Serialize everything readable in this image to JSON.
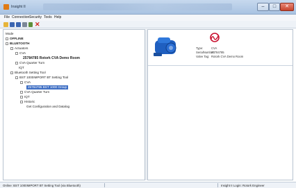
{
  "window": {
    "title": "Insight II",
    "minimize_glyph": "–",
    "maximize_glyph": "□",
    "close_glyph": "✕"
  },
  "menu": [
    "File",
    "Connection",
    "Security",
    "Tools",
    "Help"
  ],
  "toolbar": {
    "icons": [
      "open-icon",
      "save-icon",
      "save-all-icon",
      "print-icon",
      "back-icon",
      "delete-icon"
    ],
    "delete_color": "#d3261d"
  },
  "tree": {
    "root": "Mode",
    "offline": "OFFLINE",
    "bluetooth": "BLUETOOTH",
    "actuators": "Actuators",
    "cva": "CVA",
    "device": "25784785 Rotork CVA Demo Room",
    "cva_quarter_turn": "CVA Quarter Turn",
    "iqt": "IQT",
    "bst_group": "Bluetooth Setting Tool",
    "bst": "BST 1000IMPORT BT Setting Tool",
    "bst_cva": "CVA",
    "selected": "25784785 BST 1000 Group",
    "bst_cva_qt": "CVA Quarter Turn",
    "bst_iqt": "IQT",
    "historic": "Historic",
    "get_config": "Get Configuration and Datalog"
  },
  "device_info": {
    "type_label": "Type:",
    "type_value": "CVA",
    "serial_label": "SerialNumber:",
    "serial_value": "25784785",
    "tag_label": "Valve Tag:",
    "tag_value": "Rotork CVA Demo Room"
  },
  "status": {
    "left": "Online: BST 1000IMPORT BT Setting Tool (via Bluetooth)",
    "right": "Insight II Login: Rotork Engineer"
  },
  "colors": {
    "titlebar": "#b5cbe6",
    "selection": "#3f6fc4",
    "actuator_blue": "#1f5fc0",
    "logo_red": "#c8102e"
  }
}
